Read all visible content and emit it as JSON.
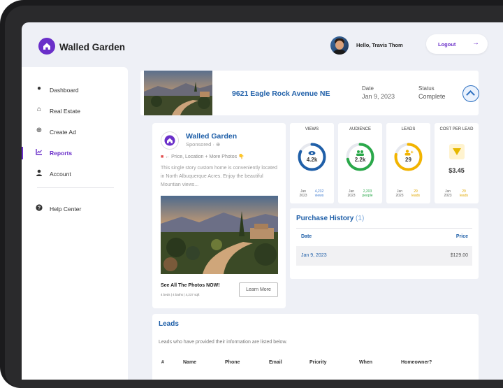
{
  "app": {
    "name": "Walled Garden"
  },
  "header": {
    "greeting": "Hello, Travis Thom",
    "logout_label": "Logout",
    "logout_icon": "arrow-right-icon"
  },
  "sidebar": {
    "items": [
      {
        "label": "Dashboard",
        "icon": "dashboard-icon"
      },
      {
        "label": "Real Estate",
        "icon": "home-icon"
      },
      {
        "label": "Create Ad",
        "icon": "plus-circle-icon"
      },
      {
        "label": "Reports",
        "icon": "chart-icon",
        "active": true
      },
      {
        "label": "Account",
        "icon": "user-icon"
      },
      {
        "label": "Help Center",
        "icon": "help-icon"
      }
    ]
  },
  "property": {
    "address": "9621 Eagle Rock Avenue NE",
    "date_label": "Date",
    "date_value": "Jan 9, 2023",
    "status_label": "Status",
    "status_value": "Complete"
  },
  "ad": {
    "name": "Walled Garden",
    "sponsored": "Sponsored · ⊕",
    "tagline": "← Price, Location + More Photos 👇",
    "text": "This single story custom home is conveniently located in North Albuquerque Acres. Enjoy the beautiful Mountian views...",
    "cta_title": "See All The Photos NOW!",
    "specs": "4 beds | 4 baths | 4,237 sqft",
    "button_label": "Learn More"
  },
  "stats": [
    {
      "title": "VIEWS",
      "value": "4.2k",
      "date": "Jan 2023",
      "detail": "4,232 views",
      "color": "#1f5fa8",
      "fraction": 0.82,
      "icon": "eye-icon"
    },
    {
      "title": "AUDIENCE",
      "value": "2.2k",
      "date": "Jan 2023",
      "detail": "2,203 people",
      "color": "#2aa84a",
      "fraction": 0.72,
      "icon": "people-icon"
    },
    {
      "title": "LEADS",
      "value": "29",
      "date": "Jan 2023",
      "detail": "29 leads",
      "color": "#f2b400",
      "fraction": 0.78,
      "icon": "user-add-icon"
    },
    {
      "title": "COST PER LEAD",
      "value": "$3.45",
      "date": "Jan 2023",
      "detail": "29 leads",
      "color": "#f2b400",
      "icon": "tag-icon"
    }
  ],
  "purchase_history": {
    "title": "Purchase History",
    "count": "(1)",
    "columns": [
      "Date",
      "Price"
    ],
    "rows": [
      {
        "date": "Jan 9, 2023",
        "price": "$129.00"
      }
    ]
  },
  "leads": {
    "title": "Leads",
    "description": "Leads who have provided their information are listed below.",
    "columns": [
      "#",
      "Name",
      "Phone",
      "Email",
      "Priority",
      "When",
      "Homeowner?"
    ]
  }
}
